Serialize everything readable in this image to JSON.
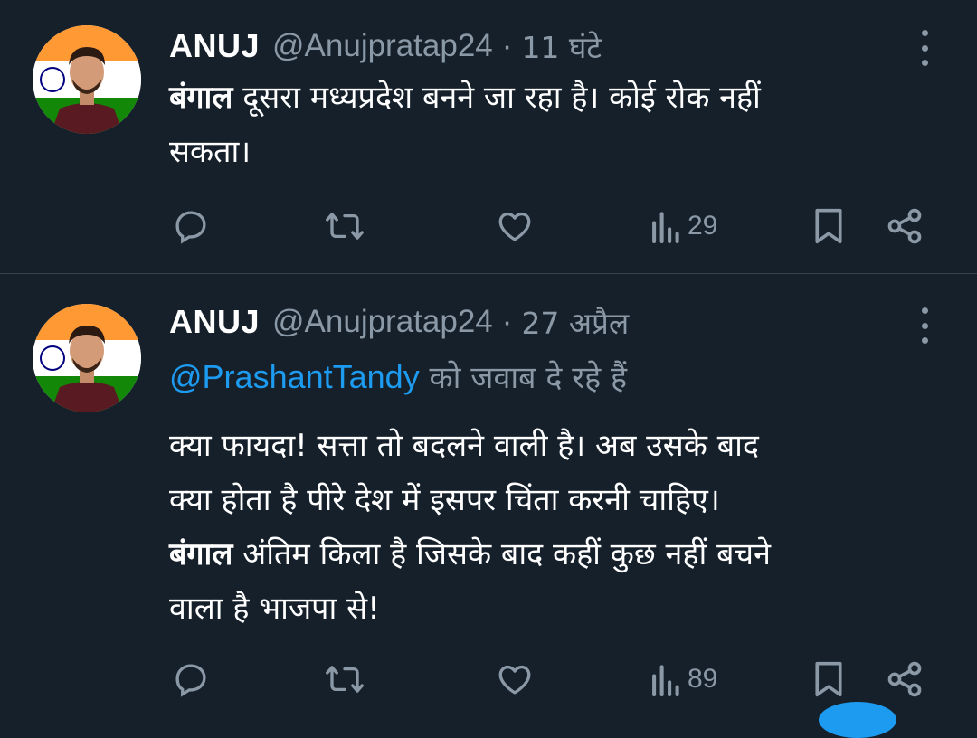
{
  "tweets": [
    {
      "author_name": "ANUJ",
      "handle": "@Anujpratap24",
      "separator": "·",
      "time": "11 घंटे",
      "body_bold_1": "बंगाल",
      "body_line_1": " दूसरा मध्यप्रदेश बनने जा रहा है। कोई रोक नहीं",
      "body_line_2": "सकता।",
      "views": "29",
      "icons": [
        "reply-icon",
        "retweet-icon",
        "like-icon",
        "views-icon",
        "bookmark-icon",
        "share-icon",
        "more-icon"
      ]
    },
    {
      "author_name": "ANUJ",
      "handle": "@Anujpratap24",
      "separator": "·",
      "time": "27 अप्रैल",
      "reply_to": "@PrashantTandy",
      "reply_suffix": " को जवाब दे रहे हैं",
      "body_line_1": "क्या फायदा! सत्ता तो बदलने वाली है। अब उसके बाद",
      "body_line_2": "क्या होता है पीरे देश में इसपर चिंता करनी चाहिए।",
      "body_bold_3": "बंगाल",
      "body_line_3": " अंतिम किला है जिसके बाद कहीं कुछ नहीं बचने",
      "body_line_4": "वाला है भाजपा से!",
      "views": "89",
      "icons": [
        "reply-icon",
        "retweet-icon",
        "like-icon",
        "views-icon",
        "bookmark-icon",
        "share-icon",
        "more-icon"
      ]
    }
  ],
  "colors": {
    "background": "#15202b",
    "text": "#ffffff",
    "muted": "#8b98a5",
    "accent": "#1d9bf0",
    "divider": "#38444d"
  }
}
